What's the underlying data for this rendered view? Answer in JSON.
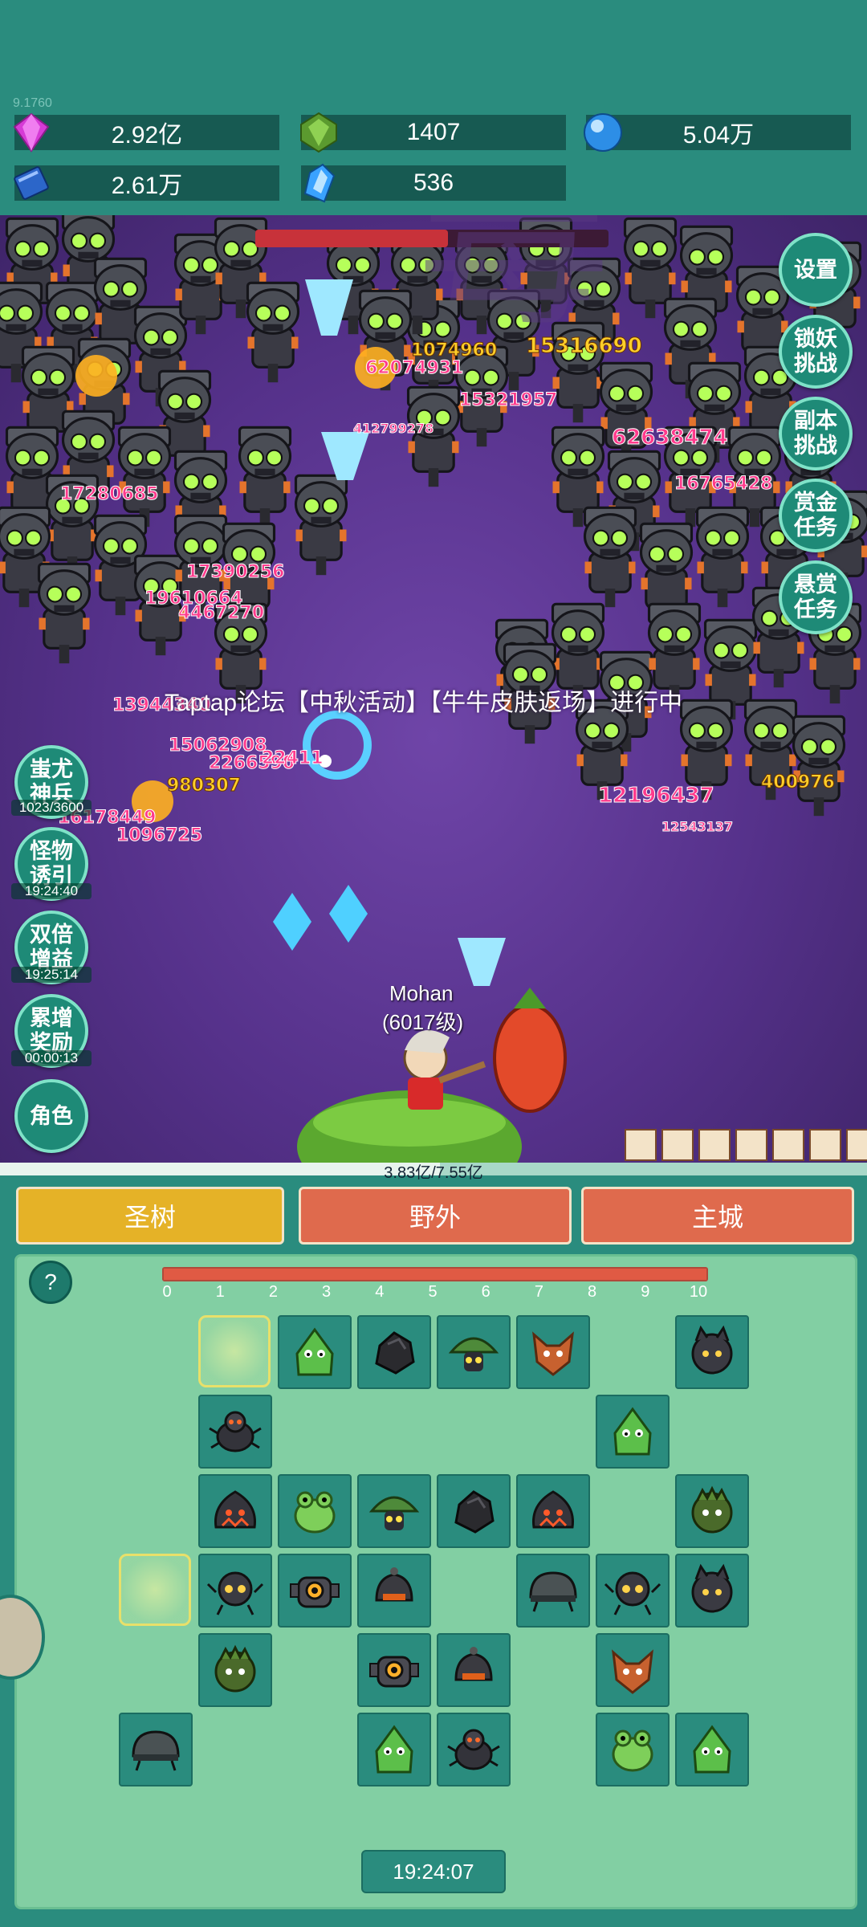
{
  "top_corner_text": "9.1760",
  "resources": [
    {
      "icon": "purple-gem-icon",
      "value": "2.92亿"
    },
    {
      "icon": "green-crystal-icon",
      "value": "1407"
    },
    {
      "icon": "blue-orb-icon",
      "value": "5.04万"
    },
    {
      "icon": "blue-book-icon",
      "value": "2.61万"
    },
    {
      "icon": "blue-shard-icon",
      "value": "536"
    }
  ],
  "right_buttons": [
    {
      "label": "设置"
    },
    {
      "label": "锁妖\n挑战"
    },
    {
      "label": "副本\n挑战"
    },
    {
      "label": "赏金\n任务"
    },
    {
      "label": "悬赏\n任务"
    }
  ],
  "left_buttons": [
    {
      "label": "蚩尤\n神兵",
      "sub": "1023/3600"
    },
    {
      "label": "怪物\n诱引",
      "sub": "19:24:40"
    },
    {
      "label": "双倍\n增益",
      "sub": "19:25:14"
    },
    {
      "label": "累增\n奖励",
      "sub": "00:00:13"
    },
    {
      "label": "角色",
      "sub": ""
    }
  ],
  "announcement": "Taptap论坛【中秋活动】【牛牛皮肤返场】进行中",
  "player": {
    "name": "Mohan",
    "level": "(6017级)"
  },
  "exp_bar": {
    "text": "3.83亿/7.55亿",
    "fraction": 0.507
  },
  "damage_numbers": [
    "17280685",
    "17390256",
    "19610664",
    "4467270",
    "13944340",
    "15062908",
    "2266590",
    "22411",
    "980307",
    "16178449",
    "1096725",
    "1074960",
    "62074931",
    "15321957",
    "412799278",
    "15316690",
    "62638474",
    "16765428",
    "12196437",
    "12543137",
    "400976"
  ],
  "tabs": [
    {
      "label": "圣树",
      "color": "#e5b227"
    },
    {
      "label": "野外",
      "color": "#df6a4d"
    },
    {
      "label": "主城",
      "color": "#df6a4d"
    }
  ],
  "help_label": "?",
  "grid_ticks": [
    "0",
    "1",
    "2",
    "3",
    "4",
    "5",
    "6",
    "7",
    "8",
    "9",
    "10"
  ],
  "grid_progress": 1.0,
  "timer": "19:24:07",
  "colors": {
    "bg": "#2a8c7e",
    "panel": "#82cfa3",
    "tab_active": "#e5b227",
    "tab": "#df6a4d"
  }
}
